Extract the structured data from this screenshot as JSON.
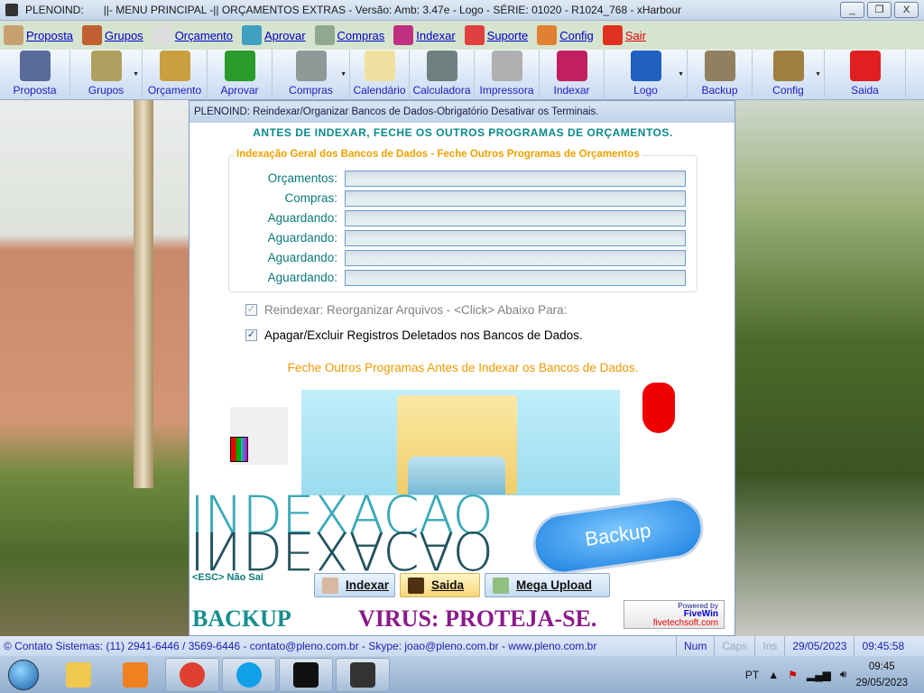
{
  "window": {
    "app": "PLENOIND:",
    "title": "||- MENU PRINCIPAL -|| ORÇAMENTOS EXTRAS - Versão: Amb: 3.47e - Logo - SÉRIE: 01020 - R1024_768 - xHarbour",
    "buttons": [
      "_",
      "❐",
      "X"
    ]
  },
  "menu": [
    {
      "label": "Proposta",
      "icon": "proposal-icon",
      "color": "#c8a070"
    },
    {
      "label": "Grupos",
      "icon": "books-icon",
      "color": "#c06030"
    },
    {
      "label": "Orçamento",
      "icon": "book-icon",
      "color": "#ddd"
    },
    {
      "label": "Aprovar",
      "icon": "approve-icon",
      "color": "#40a0c0"
    },
    {
      "label": "Compras",
      "icon": "cart-icon",
      "color": "#90a890"
    },
    {
      "label": "Indexar",
      "icon": "index-icon",
      "color": "#c03080"
    },
    {
      "label": "Suporte",
      "icon": "first-aid-icon",
      "color": "#e04040"
    },
    {
      "label": "Config",
      "icon": "users-icon",
      "color": "#e08030"
    },
    {
      "label": "Sair",
      "icon": "power-icon",
      "color": "#e03020"
    }
  ],
  "toolbar": [
    {
      "label": "Proposta",
      "icon": "proposal-icon",
      "color": "#5a6a9a",
      "dd": false,
      "w": 78
    },
    {
      "label": "Grupos",
      "icon": "books-icon",
      "color": "#b0a060",
      "dd": true,
      "w": 80
    },
    {
      "label": "Orçamento",
      "icon": "folder-icon",
      "color": "#c8a040",
      "dd": false,
      "w": 72
    },
    {
      "label": "Aprovar",
      "icon": "approve-icon",
      "color": "#2a9a2a",
      "dd": false,
      "w": 72
    },
    {
      "label": "Compras",
      "icon": "cart-icon",
      "color": "#909898",
      "dd": true,
      "w": 86
    },
    {
      "label": "Calendário",
      "icon": "calendar-icon",
      "color": "#f0e0a0",
      "dd": false,
      "w": 66
    },
    {
      "label": "Calculadora",
      "icon": "calculator-icon",
      "color": "#708080",
      "dd": false,
      "w": 72
    },
    {
      "label": "Impressora",
      "icon": "printer-icon",
      "color": "#b0b0b0",
      "dd": false,
      "w": 72
    },
    {
      "label": "Indexar",
      "icon": "index-icon",
      "color": "#c02060",
      "dd": false,
      "w": 72
    },
    {
      "label": "Logo",
      "icon": "info-icon",
      "color": "#2060c0",
      "dd": true,
      "w": 92
    },
    {
      "label": "Backup",
      "icon": "shield-icon",
      "color": "#908060",
      "dd": false,
      "w": 72
    },
    {
      "label": "Config",
      "icon": "gate-icon",
      "color": "#a08040",
      "dd": true,
      "w": 80
    },
    {
      "label": "Saida",
      "icon": "power-icon",
      "color": "#e02020",
      "dd": false,
      "w": 90
    }
  ],
  "dialog": {
    "title": "PLENOIND: Reindexar/Organizar Bancos de Dados-Obrigatório Desativar os Terminais.",
    "warning": "ANTES DE INDEXAR, FECHE OS OUTROS PROGRAMAS DE ORÇAMENTOS.",
    "group_title": "Indexação Geral dos Bancos de Dados - Feche Outros Programas de Orçamentos",
    "fields": [
      {
        "label": "Orçamentos:",
        "value": ""
      },
      {
        "label": "Compras:",
        "value": ""
      },
      {
        "label": "Aguardando:",
        "value": ""
      },
      {
        "label": "Aguardando:",
        "value": ""
      },
      {
        "label": "Aguardando:",
        "value": ""
      },
      {
        "label": "Aguardando:",
        "value": ""
      }
    ],
    "check1": {
      "label": "Reindexar: Reorganizar Arquivos - <Click> Abaixo Para:",
      "checked": true,
      "disabled": true
    },
    "check2": {
      "label": "Apagar/Excluir Registros Deletados nos Bancos de Dados.",
      "checked": true
    },
    "note": "Feche Outros Programas Antes de Indexar os Bancos de Dados.",
    "big_text": "INDEXACAO",
    "cloud_label": "Backup",
    "esc": "<ESC> Não Sai",
    "buttons": {
      "indexar": "Indexar",
      "saida": "Saida",
      "mega": "Mega Upload"
    },
    "backup": "BACKUP",
    "virus": "VIRUS: PROTEJA-SE.",
    "fivewin": {
      "a": "Powered by",
      "b": "FiveWin",
      "c": "fivetechsoft.com"
    }
  },
  "status": {
    "contact": "© Contato Sistemas: (11) 2941-6446 / 3569-6446 - contato@pleno.com.br - Skype: joao@pleno.com.br - www.pleno.com.br",
    "num": "Num",
    "caps": "Caps",
    "ins": "Ins",
    "date": "29/05/2023",
    "time": "09:45:58"
  },
  "taskbar": {
    "lang": "PT",
    "time": "09:45",
    "date": "29/05/2023",
    "tasks": [
      {
        "name": "explorer",
        "color": "#f0c850",
        "open": false
      },
      {
        "name": "media-player",
        "color": "#f08020",
        "open": false
      },
      {
        "name": "chrome",
        "color": "#e04030",
        "open": true
      },
      {
        "name": "skype",
        "color": "#10a0e8",
        "open": true
      },
      {
        "name": "cmd",
        "color": "#111",
        "open": true
      },
      {
        "name": "phone-app",
        "color": "#333",
        "open": true
      }
    ]
  }
}
